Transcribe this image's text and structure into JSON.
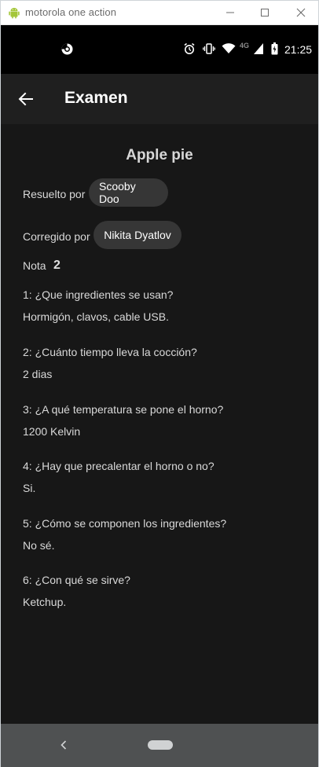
{
  "window": {
    "title": "motorola one action"
  },
  "status_bar": {
    "time": "21:25",
    "network": "4G"
  },
  "app_bar": {
    "title": "Examen"
  },
  "exam": {
    "title": "Apple pie",
    "solved_by_label": "Resuelto por",
    "solved_by": "Scooby Doo",
    "corrected_by_label": "Corregido por",
    "corrected_by": "Nikita Dyatlov",
    "grade_label": "Nota",
    "grade": "2"
  },
  "questions": [
    {
      "question": "1: ¿Que ingredientes se usan?",
      "answer": "Hormigón, clavos, cable USB."
    },
    {
      "question": "2: ¿Cuánto tiempo lleva la cocción?",
      "answer": "2 dias"
    },
    {
      "question": "3: ¿A qué temperatura se pone el horno?",
      "answer": "1200 Kelvin"
    },
    {
      "question": "4: ¿Hay que precalentar el horno o no?",
      "answer": "Si."
    },
    {
      "question": "5: ¿Cómo se componen los ingredientes?",
      "answer": "No sé."
    },
    {
      "question": "6: ¿Con qué se sirve?",
      "answer": "Ketchup."
    }
  ],
  "icons": {
    "app": "android-icon",
    "minimize": "minimize-icon",
    "maximize": "maximize-icon",
    "close": "close-icon",
    "back": "arrow-left-icon",
    "nav_back": "chevron-left-icon"
  },
  "colors": {
    "background": "#171717",
    "app_bar": "#1f1f1f",
    "chip": "#363636",
    "nav_bar": "#4f5152",
    "android_green": "#a4c639"
  }
}
